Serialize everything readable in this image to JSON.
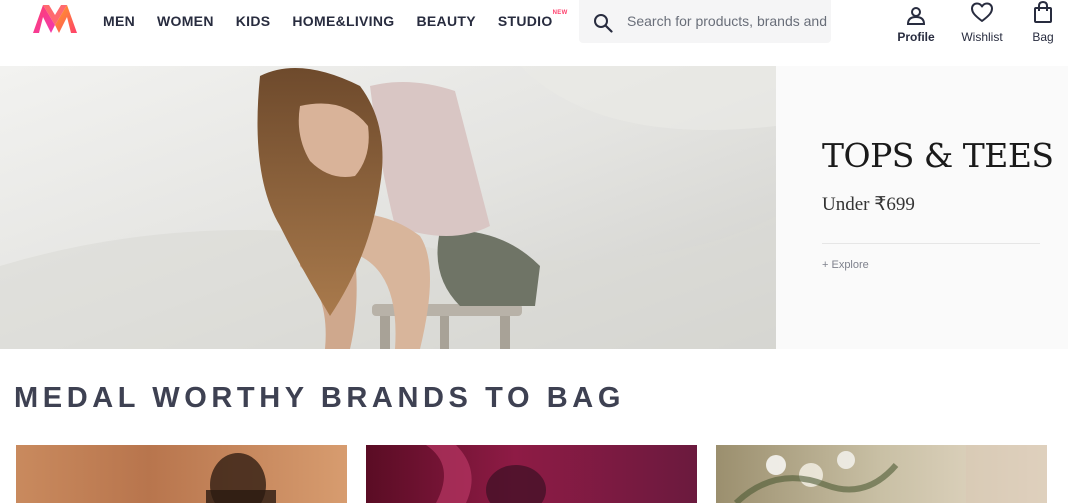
{
  "header": {
    "nav": [
      "MEN",
      "WOMEN",
      "KIDS",
      "HOME&LIVING",
      "BEAUTY",
      "STUDIO"
    ],
    "studio_badge": "NEW",
    "search": {
      "placeholder": "Search for products, brands and more"
    },
    "actions": {
      "profile": "Profile",
      "wishlist": "Wishlist",
      "bag": "Bag"
    }
  },
  "hero": {
    "title": "TOPS & TEES",
    "subtitle": "Under ₹699",
    "link": "+ Explore"
  },
  "section": {
    "title": "MEDAL WORTHY BRANDS TO BAG"
  },
  "colors": {
    "brand_pink": "#ff3f6c",
    "text_dark": "#282c3f"
  }
}
